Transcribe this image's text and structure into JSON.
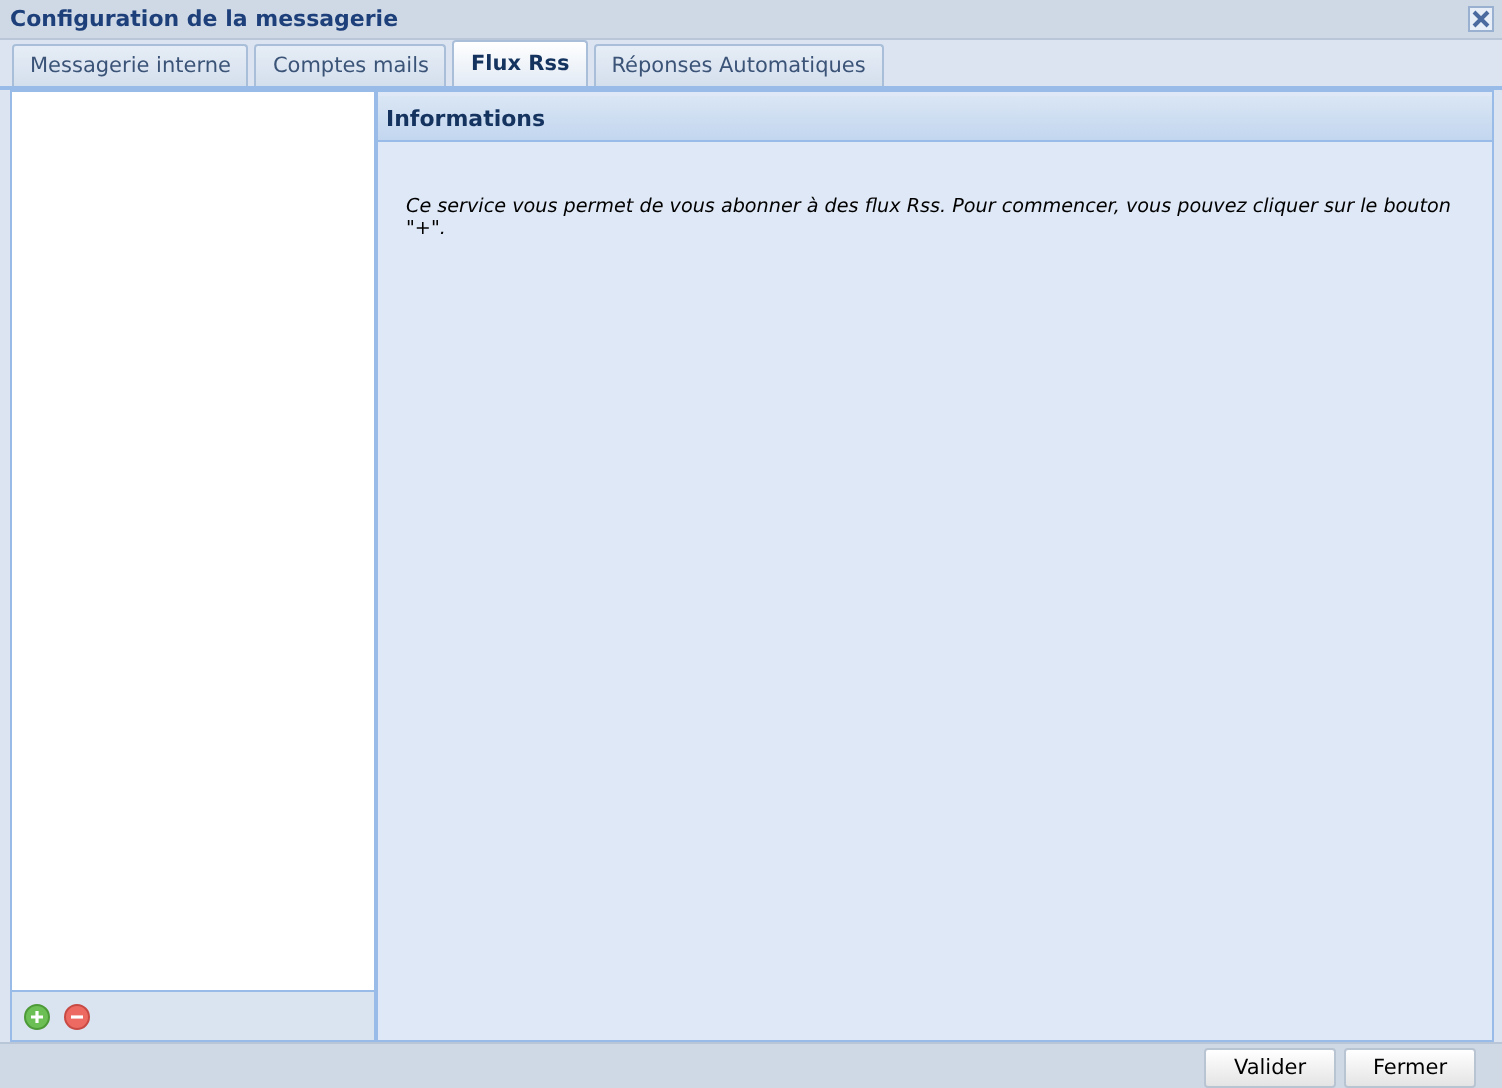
{
  "window": {
    "title": "Configuration de la messagerie"
  },
  "tabs": [
    {
      "label": "Messagerie interne",
      "selected": false
    },
    {
      "label": "Comptes mails",
      "selected": false
    },
    {
      "label": "Flux Rss",
      "selected": true
    },
    {
      "label": "Réponses Automatiques",
      "selected": false
    }
  ],
  "panel": {
    "title": "Informations",
    "text": "Ce service vous permet de vous abonner à des flux Rss. Pour commencer, vous pouvez cliquer sur le bouton \"+\"."
  },
  "buttons": [
    "Valider",
    "Fermer"
  ]
}
